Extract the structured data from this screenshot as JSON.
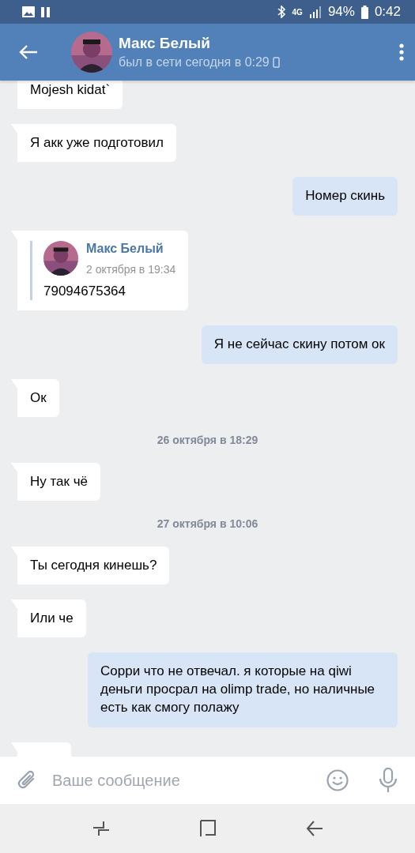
{
  "status_bar": {
    "battery": "94%",
    "time": "0:42",
    "network": "4G"
  },
  "header": {
    "name": "Макс Белый",
    "status": "был в сети сегодня в 0:29"
  },
  "messages": [
    {
      "kind": "incoming",
      "text": "Mojesh kidat`"
    },
    {
      "kind": "incoming",
      "text": "Я акк уже подготовил"
    },
    {
      "kind": "outgoing",
      "text": "Номер скинь"
    },
    {
      "kind": "forward",
      "author": "Макс Белый",
      "date": "2 октября в 19:34",
      "text": "79094675364"
    },
    {
      "kind": "outgoing",
      "text": "Я не сейчас скину потом ок"
    },
    {
      "kind": "incoming",
      "text": "Ок"
    },
    {
      "kind": "date",
      "text": "26 октября в 18:29"
    },
    {
      "kind": "incoming",
      "text": "Ну так чё"
    },
    {
      "kind": "date",
      "text": "27 октября в 10:06"
    },
    {
      "kind": "incoming",
      "text": "Ты сегодня кинешь?"
    },
    {
      "kind": "incoming",
      "text": "Или че"
    },
    {
      "kind": "outgoing",
      "text": "Сорри что не отвечал. я которые на qiwi деньги просрал на olimp trade, но наличные есть как смогу полажу"
    },
    {
      "kind": "partial"
    }
  ],
  "composer": {
    "placeholder": "Ваше сообщение"
  }
}
